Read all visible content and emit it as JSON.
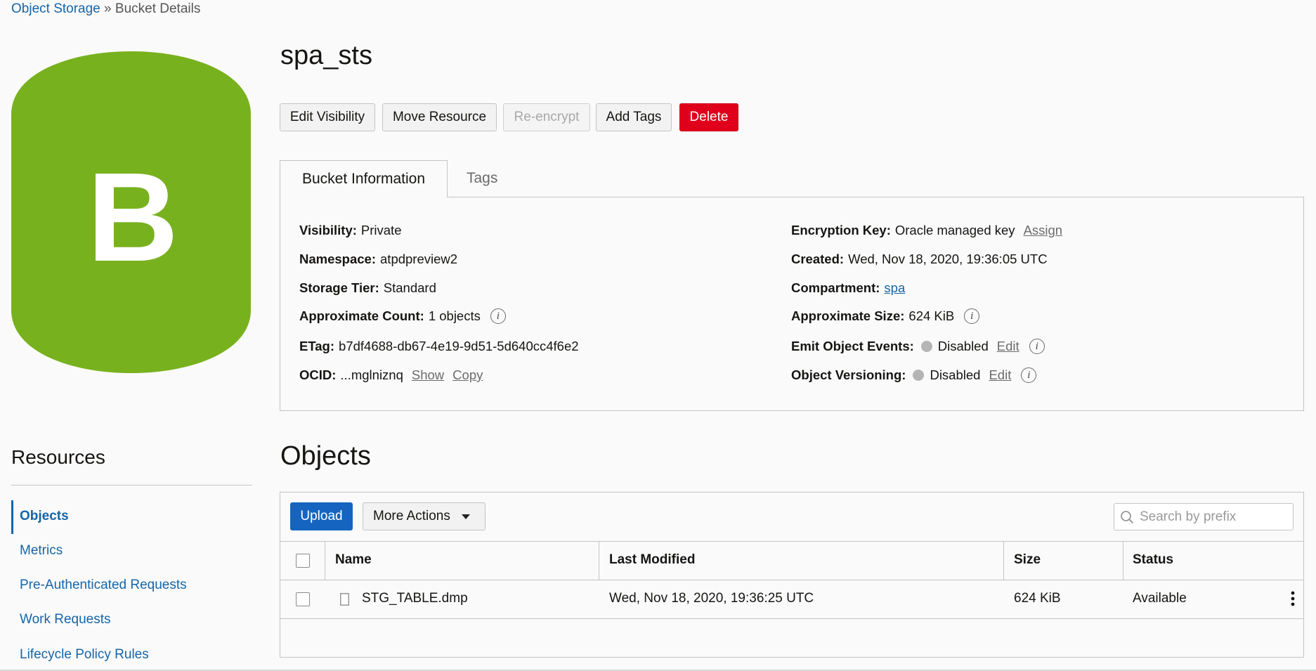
{
  "breadcrumb": {
    "root": "Object Storage",
    "separator": "»",
    "current": "Bucket Details"
  },
  "bucket_icon": {
    "letter": "B",
    "color": "#78b11e"
  },
  "title": "spa_sts",
  "actions": {
    "edit_visibility": "Edit Visibility",
    "move_resource": "Move Resource",
    "re_encrypt": "Re-encrypt",
    "add_tags": "Add Tags",
    "delete": "Delete"
  },
  "tabs": {
    "bucket_info": "Bucket Information",
    "tags": "Tags"
  },
  "info": {
    "visibility": {
      "label": "Visibility:",
      "value": "Private"
    },
    "namespace": {
      "label": "Namespace:",
      "value": "atpdpreview2"
    },
    "storage_tier": {
      "label": "Storage Tier:",
      "value": "Standard"
    },
    "approx_count": {
      "label": "Approximate Count:",
      "value": "1 objects"
    },
    "etag": {
      "label": "ETag:",
      "value": "b7df4688-db67-4e19-9d51-5d640cc4f6e2"
    },
    "ocid": {
      "label": "OCID:",
      "value": "...mglniznq",
      "show": "Show",
      "copy": "Copy"
    },
    "encryption_key": {
      "label": "Encryption Key:",
      "value": "Oracle managed key",
      "action": "Assign"
    },
    "created": {
      "label": "Created:",
      "value": "Wed, Nov 18, 2020, 19:36:05 UTC"
    },
    "compartment": {
      "label": "Compartment:",
      "value": "spa"
    },
    "approx_size": {
      "label": "Approximate Size:",
      "value": "624 KiB"
    },
    "emit_events": {
      "label": "Emit Object Events:",
      "value": "Disabled",
      "action": "Edit"
    },
    "versioning": {
      "label": "Object Versioning:",
      "value": "Disabled",
      "action": "Edit"
    },
    "info_glyph": "i"
  },
  "resources": {
    "heading": "Resources",
    "items": [
      "Objects",
      "Metrics",
      "Pre-Authenticated Requests",
      "Work Requests",
      "Lifecycle Policy Rules"
    ]
  },
  "objects": {
    "heading": "Objects",
    "upload": "Upload",
    "more_actions": "More Actions",
    "search_placeholder": "Search by prefix",
    "columns": [
      "Name",
      "Last Modified",
      "Size",
      "Status"
    ],
    "rows": [
      {
        "name": "STG_TABLE.dmp",
        "last_modified": "Wed, Nov 18, 2020, 19:36:25 UTC",
        "size": "624 KiB",
        "status": "Available"
      }
    ]
  },
  "colors": {
    "accent": "#1565c0",
    "danger": "#e0001b",
    "bucket": "#78b11e"
  }
}
